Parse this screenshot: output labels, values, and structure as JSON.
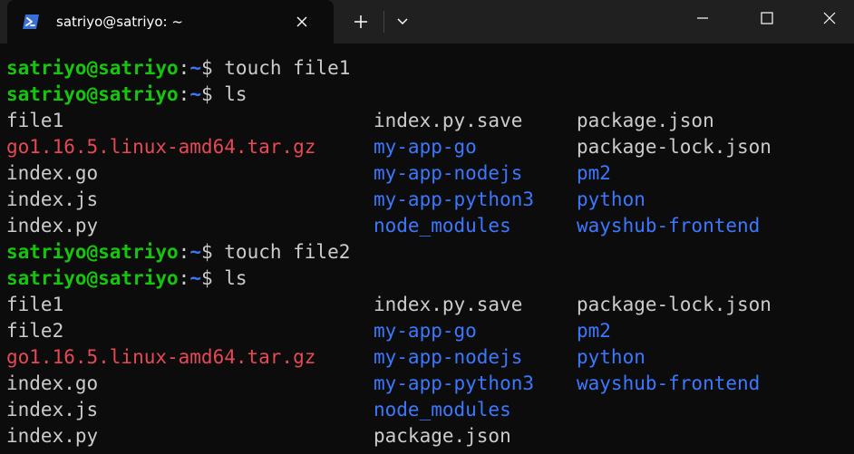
{
  "window": {
    "tab_title": "satriyo@satriyo: ~",
    "new_tab_symbol": "+",
    "colors": {
      "titlebar": "#202020",
      "terminal_bg": "#0c0c0c",
      "prompt_user": "#16c60c",
      "prompt_path": "#3b78ff",
      "text": "#cccccc",
      "directory": "#3b78ff",
      "archive": "#e74856"
    },
    "icons": {
      "tab": "powershell-icon",
      "close_tab": "close-icon",
      "new_tab": "plus-icon",
      "dropdown": "chevron-down-icon",
      "minimize": "minimize-icon",
      "maximize": "maximize-icon",
      "close_window": "close-icon"
    }
  },
  "prompt": {
    "user": "satriyo@satriyo",
    "colon": ":",
    "path": "~",
    "symbol": "$"
  },
  "commands": [
    "touch file1",
    "ls",
    "touch file2",
    "ls"
  ],
  "listing1": [
    [
      "file1",
      "index.py.save",
      "package.json"
    ],
    [
      "go1.16.5.linux-amd64.tar.gz",
      "my-app-go",
      "package-lock.json"
    ],
    [
      "index.go",
      "my-app-nodejs",
      "pm2"
    ],
    [
      "index.js",
      "my-app-python3",
      "python"
    ],
    [
      "index.py",
      "node_modules",
      "wayshub-frontend"
    ]
  ],
  "listing2": [
    [
      "file1",
      "index.py.save",
      "package-lock.json"
    ],
    [
      "file2",
      "my-app-go",
      "pm2"
    ],
    [
      "go1.16.5.linux-amd64.tar.gz",
      "my-app-nodejs",
      "python"
    ],
    [
      "index.go",
      "my-app-python3",
      "wayshub-frontend"
    ],
    [
      "index.js",
      "node_modules",
      ""
    ],
    [
      "index.py",
      "package.json",
      ""
    ]
  ]
}
